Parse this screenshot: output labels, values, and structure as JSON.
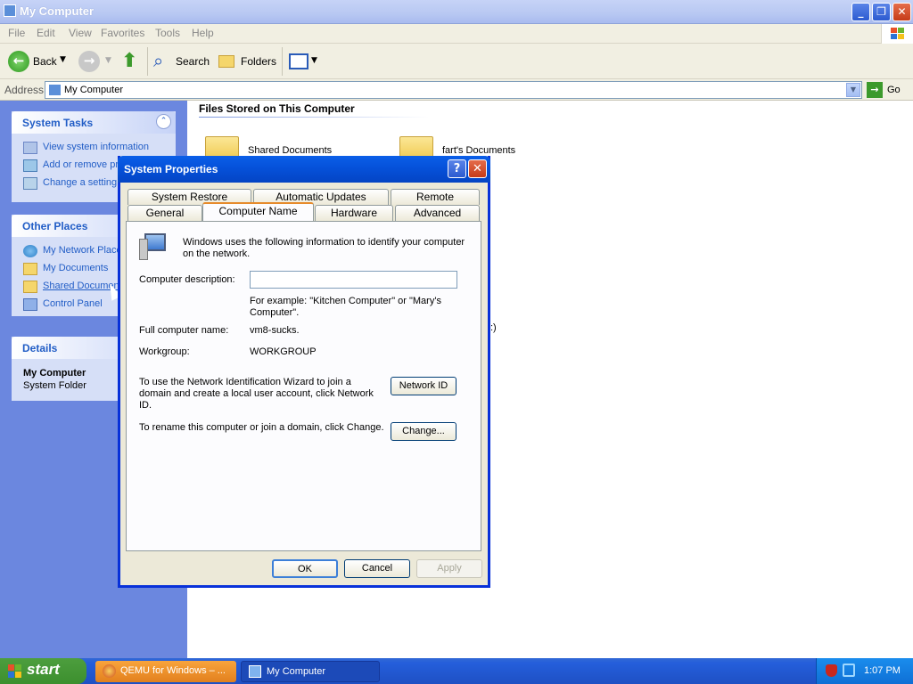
{
  "window": {
    "title": "My Computer"
  },
  "menu": [
    "File",
    "Edit",
    "View",
    "Favorites",
    "Tools",
    "Help"
  ],
  "toolbar": {
    "back_label": "Back",
    "search_label": "Search",
    "folders_label": "Folders"
  },
  "address": {
    "label": "Address",
    "value": "My Computer",
    "go_label": "Go"
  },
  "left_pane": {
    "system_tasks": {
      "title": "System Tasks",
      "items": [
        "View system information",
        "Add or remove programs",
        "Change a setting"
      ]
    },
    "other_places": {
      "title": "Other Places",
      "items": [
        "My Network Places",
        "My Documents",
        "Shared Documents",
        "Control Panel"
      ]
    },
    "details": {
      "title": "Details",
      "name": "My Computer",
      "type": "System Folder"
    }
  },
  "main": {
    "section_title": "Files Stored on This Computer",
    "folders": [
      "Shared Documents",
      "fart's Documents"
    ],
    "partial_text": ":)"
  },
  "dialog": {
    "title": "System Properties",
    "tabs_top": [
      "System Restore",
      "Automatic Updates",
      "Remote"
    ],
    "tabs_bottom": [
      "General",
      "Computer Name",
      "Hardware",
      "Advanced"
    ],
    "intro": "Windows uses the following information to identify your computer on the network.",
    "description_label": "Computer description:",
    "description_value": "",
    "example": "For example: \"Kitchen Computer\" or \"Mary's Computer\".",
    "full_name_label": "Full computer name:",
    "full_name_value": "vm8-sucks.",
    "workgroup_label": "Workgroup:",
    "workgroup_value": "WORKGROUP",
    "network_id_text": "To use the Network Identification Wizard to join a domain and create a local user account, click Network ID.",
    "network_id_button": "Network ID",
    "rename_text": "To rename this computer or join a domain, click Change.",
    "change_button": "Change...",
    "ok_button": "OK",
    "cancel_button": "Cancel",
    "apply_button": "Apply"
  },
  "taskbar": {
    "start_label": "start",
    "tasks": [
      "QEMU for Windows – ...",
      "My Computer"
    ],
    "clock": "1:07 PM"
  }
}
